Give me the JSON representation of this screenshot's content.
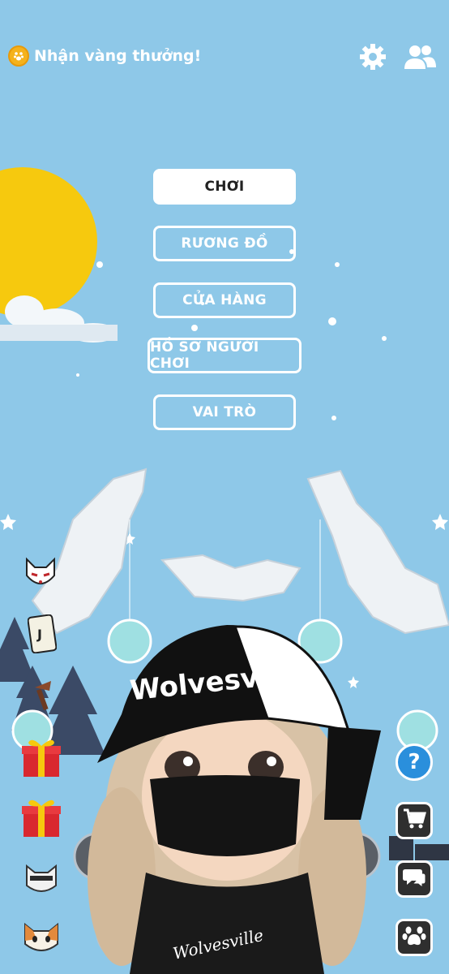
{
  "header": {
    "reward_label": "Nhận vàng thưởng!",
    "settings_icon": "gear-icon",
    "friends_icon": "friends-icon"
  },
  "menu": {
    "play": "CHƠI",
    "inventory": "RƯƠNG ĐỒ",
    "shop": "CỬA HÀNG",
    "profile": "HỒ SƠ NGƯỜI CHƠI",
    "roles": "VAI TRÒ"
  },
  "avatar": {
    "cap_text": "Wolvesville",
    "shirt_text": "Wolvesville"
  },
  "side_left": [
    "kitsune-mask-icon",
    "joker-card-icon",
    "torch-icon",
    "gift-box-icon",
    "gift-box-icon",
    "cat-skin-icon",
    "calico-cat-icon"
  ],
  "side_right": [
    "help-icon",
    "shopping-cart-icon",
    "chat-icon",
    "paw-icon"
  ],
  "help_label": "?",
  "colors": {
    "sky": "#8ec8e8",
    "sun": "#f6c90e",
    "button_border": "#ffffff",
    "dark_button": "#2f2f2f",
    "help_blue": "#2a8fdc"
  }
}
